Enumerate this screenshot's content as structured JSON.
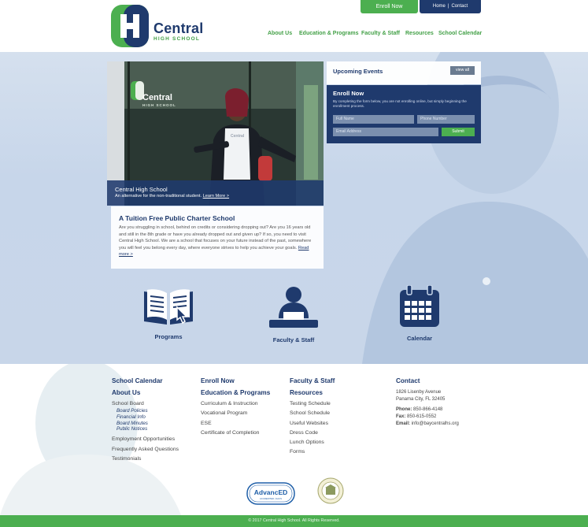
{
  "header": {
    "logo_name": "Central",
    "logo_sub": "HIGH SCHOOL",
    "enroll_button": "Enroll Now",
    "util_home": "Home",
    "util_sep": "|",
    "util_contact": "Contact",
    "nav": [
      "About Us",
      "Education & Programs",
      "Faculty & Staff",
      "Resources",
      "School Calendar"
    ]
  },
  "hero": {
    "photo_sign_name": "Central",
    "photo_sign_sub": "HIGH SCHOOL",
    "photo_shirt": "Central",
    "caption_title": "Central High School",
    "caption_desc": "An alternative for the non-traditional student.",
    "caption_more": "Learn More >"
  },
  "charter": {
    "heading": "A Tuition Free Public Charter School",
    "body": "Are you struggling in school, behind on credits or considering dropping out? Are you 16 years old and still in the 8th grade or have you already dropped out and given up? If so, you need to visit Central High School. We are a school that focuses on your future instead of the past, somewhere you will feel you belong every day, where everyone strives to help you achieve your goals.",
    "read_more": "Read more >"
  },
  "events": {
    "heading": "Upcoming Events",
    "view_all": "view all"
  },
  "enroll_form": {
    "heading": "Enroll Now",
    "desc": "By completing the form below, you are not enrolling online, but simply beginning the enrollment process.",
    "name_placeholder": "Full Name",
    "phone_placeholder": "Phone Number",
    "email_placeholder": "Email Address",
    "submit": "Submit"
  },
  "features": [
    {
      "label": "Programs",
      "icon": "book-icon"
    },
    {
      "label": "Faculty & Staff",
      "icon": "teacher-icon"
    },
    {
      "label": "Calendar",
      "icon": "calendar-icon"
    }
  ],
  "footer": {
    "col1": {
      "heading1": "School Calendar",
      "heading2": "About Us",
      "links": [
        "School Board"
      ],
      "sub": [
        "Board Policies",
        "Financial Info",
        "Board Minutes",
        "Public Notices"
      ],
      "links2": [
        "Employment Opportunities",
        "Frequently Asked Questions",
        "Testimonials"
      ]
    },
    "col2": {
      "heading1": "Enroll Now",
      "heading2": "Education & Programs",
      "links": [
        "Curriculum & Instruction",
        "Vocational Program",
        "ESE",
        "Certificate of Completion"
      ]
    },
    "col3": {
      "heading1": "Faculty & Staff",
      "heading2": "Resources",
      "links": [
        "Testing Schedule",
        "School Schedule",
        "Useful Websites",
        "Dress Code",
        "Lunch Options",
        "Forms"
      ]
    },
    "contact": {
      "heading": "Contact",
      "address1": "1826 Lisenby Avenue",
      "address2": "Panama City, FL 32405",
      "phone_label": "Phone:",
      "phone": "850-866-4148",
      "fax_label": "Fax:",
      "fax": "850-615-0552",
      "email_label": "Email:",
      "email": "info@baycentralhs.org"
    },
    "badge_advanced": "AdvancED",
    "badge_advanced_sub": "ACCREDITED | SACS",
    "copyright": "© 2017 Central High School. All Rights Reserved."
  },
  "colors": {
    "navy": "#1f3a6d",
    "green": "#4caf50",
    "hero_bg": "#c7d6ea"
  }
}
